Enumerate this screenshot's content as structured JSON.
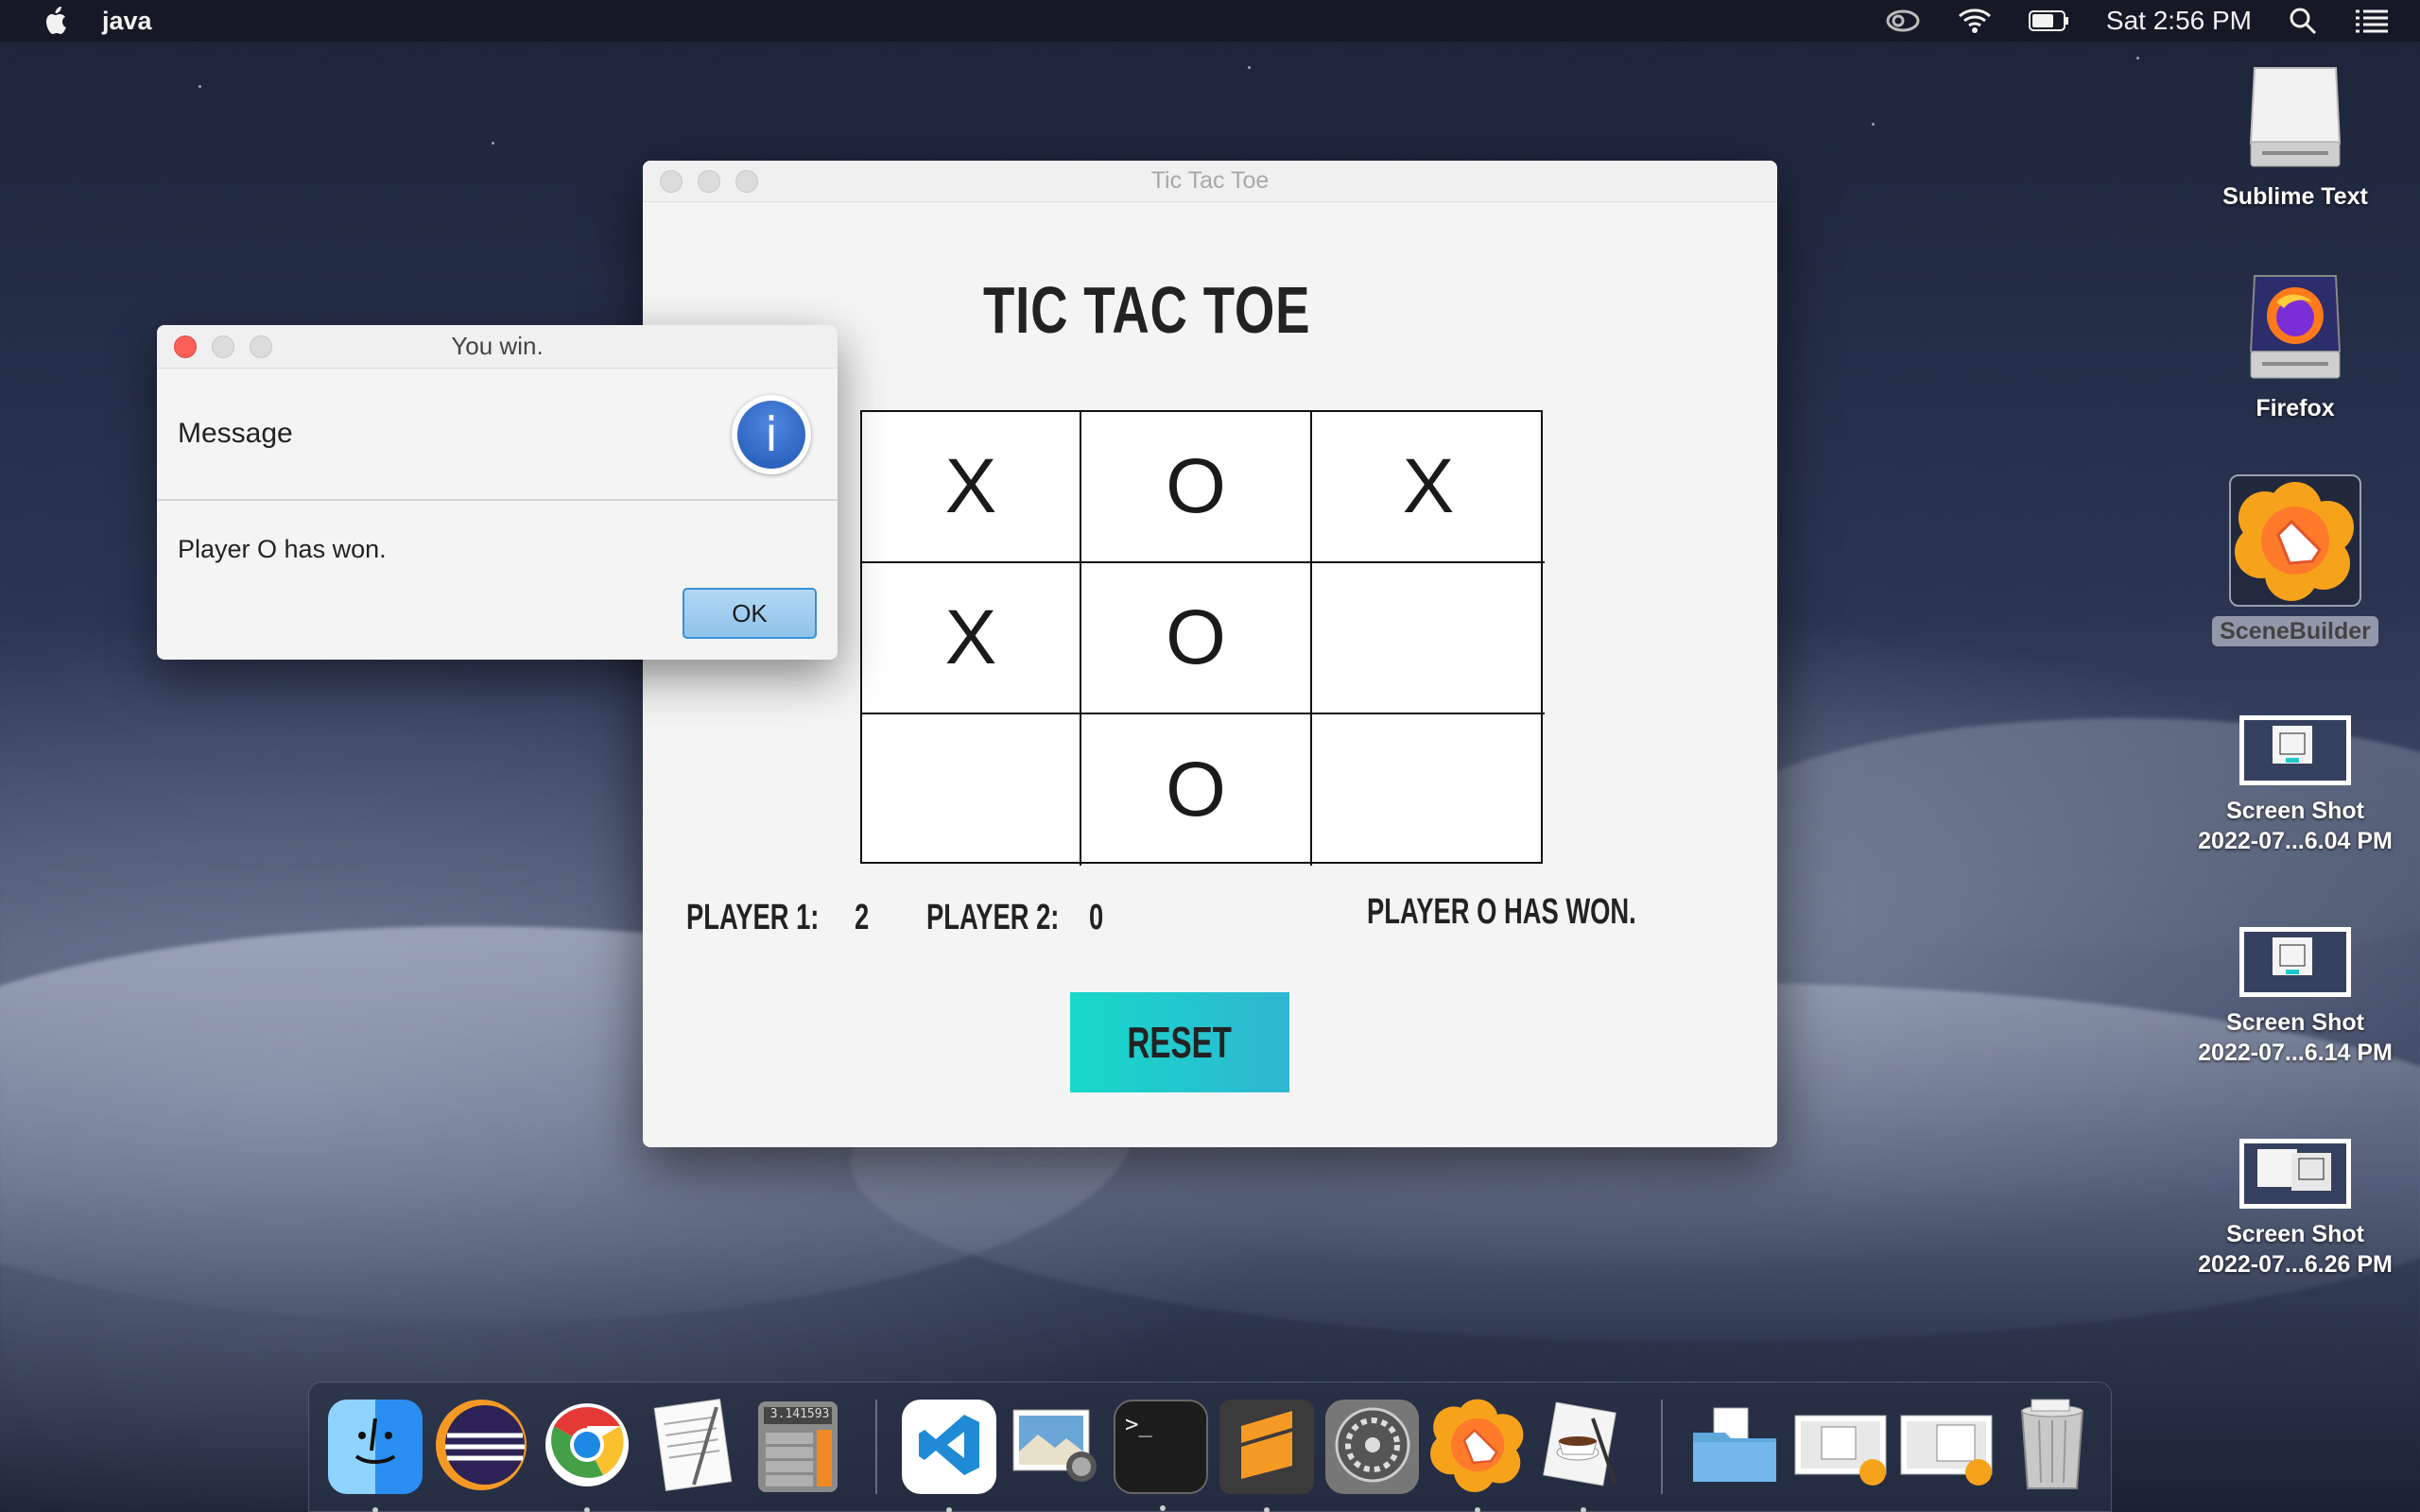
{
  "menubar": {
    "app_name": "java",
    "clock": "Sat 2:56 PM",
    "icons": [
      "apple-icon",
      "creative-cloud-icon",
      "wifi-icon",
      "battery-icon",
      "spotlight-search-icon",
      "control-center-icon"
    ]
  },
  "game_window": {
    "title": "Tic Tac Toe",
    "heading": "TIC TAC TOE",
    "board": [
      "X",
      "O",
      "X",
      "X",
      "O",
      "",
      "",
      "O",
      ""
    ],
    "player1_label": "PLAYER 1:",
    "player1_score": "2",
    "player2_label": "PLAYER 2:",
    "player2_score": "0",
    "status": "PLAYER O HAS WON.",
    "reset_label": "RESET"
  },
  "alert": {
    "title": "You win.",
    "header": "Message",
    "body": "Player O has won.",
    "ok_label": "OK",
    "icon": "info-icon"
  },
  "desktop": {
    "items": [
      {
        "label": "Sublime Text",
        "icon": "drive-icon"
      },
      {
        "label": "Firefox",
        "icon": "firefox-drive-icon"
      },
      {
        "label": "SceneBuilder",
        "icon": "scenebuilder-icon"
      },
      {
        "label": "Screen Shot",
        "label2": "2022-07...6.04 PM",
        "icon": "screenshot-thumbnail-icon"
      },
      {
        "label": "Screen Shot",
        "label2": "2022-07...6.14 PM",
        "icon": "screenshot-thumbnail-icon"
      },
      {
        "label": "Screen Shot",
        "label2": "2022-07...6.26 PM",
        "icon": "screenshot-thumbnail-icon"
      }
    ]
  },
  "dock": {
    "apps": [
      "finder",
      "eclipse",
      "chrome",
      "textedit",
      "calculator",
      "vscode",
      "preview",
      "terminal",
      "sublime-text",
      "system-preferences",
      "scenebuilder",
      "java-launcher",
      "downloads-folder",
      "screenshot-stack",
      "screenshot-stack",
      "trash"
    ],
    "calculator_display": "3.141593"
  },
  "colors": {
    "reset_gradient_start": "#16d9c9",
    "reset_gradient_end": "#2fb6d2",
    "close_button": "#fc5f57",
    "info_blue": "#2f6ccc"
  }
}
